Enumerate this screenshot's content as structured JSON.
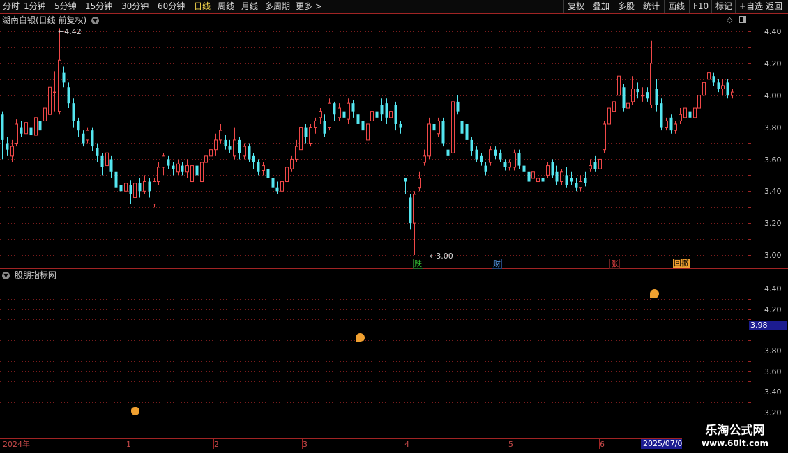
{
  "toolbar": {
    "periods": [
      "分时",
      "1分钟",
      "5分钟",
      "15分钟",
      "30分钟",
      "60分钟",
      "日线",
      "周线",
      "月线",
      "多周期",
      "更多"
    ],
    "active": "日线",
    "more_arrow": ">",
    "right_buttons": [
      "复权",
      "叠加",
      "多股",
      "统计",
      "画线",
      "F10",
      "标记",
      "+自选",
      "返回"
    ]
  },
  "main_panel": {
    "title": "湖南白银(日线 前复权)",
    "high_label": "4.42",
    "low_label": "3.00",
    "axis_labels": [
      "4.40",
      "4.20",
      "4.00",
      "3.80",
      "3.60",
      "3.40",
      "3.20",
      "3.00"
    ],
    "events": [
      {
        "text": "跌",
        "color": "#30c030"
      },
      {
        "text": "财",
        "color": "#5aa8ff"
      },
      {
        "text": "张",
        "color": "#e04040"
      },
      {
        "text": "回撤",
        "color": "#f0a030"
      }
    ]
  },
  "indicator_panel": {
    "title": "股朋指标网",
    "axis_labels": [
      "4.40",
      "4.20",
      "3.80",
      "3.60",
      "3.40",
      "3.20"
    ],
    "current_value": "3.98"
  },
  "date_axis": {
    "labels": [
      "2024年",
      "1",
      "2",
      "3",
      "4",
      "5",
      "6"
    ],
    "current_date": "2025/07/0"
  },
  "watermark": {
    "title": "乐淘公式网",
    "url": "www.60lt.com"
  },
  "colors": {
    "up": "#f04848",
    "down": "#54e6f0",
    "grid": "#7a1c1c",
    "border": "#a02424",
    "highlight": "#1c1c90"
  },
  "chart_data": {
    "type": "candlestick",
    "ylim": [
      2.95,
      4.5
    ],
    "low": 3.0,
    "high": 4.42,
    "candles": [
      [
        3.88,
        3.72,
        3.6,
        3.9
      ],
      [
        3.7,
        3.66,
        3.62,
        3.74
      ],
      [
        3.62,
        3.68,
        3.58,
        3.72
      ],
      [
        3.7,
        3.82,
        3.68,
        3.85
      ],
      [
        3.8,
        3.76,
        3.74,
        3.84
      ],
      [
        3.76,
        3.83,
        3.72,
        3.85
      ],
      [
        3.8,
        3.75,
        3.73,
        3.86
      ],
      [
        3.75,
        3.86,
        3.72,
        3.88
      ],
      [
        3.84,
        3.78,
        3.74,
        3.9
      ],
      [
        3.84,
        3.92,
        3.8,
        4.0
      ],
      [
        3.88,
        4.05,
        3.86,
        4.06
      ],
      [
        4.02,
        4.02,
        3.9,
        4.15
      ],
      [
        3.9,
        4.22,
        3.88,
        4.42
      ],
      [
        4.14,
        4.08,
        4.05,
        4.18
      ],
      [
        4.05,
        3.95,
        3.92,
        4.08
      ],
      [
        3.95,
        3.84,
        3.8,
        3.98
      ],
      [
        3.84,
        3.78,
        3.74,
        3.86
      ],
      [
        3.76,
        3.7,
        3.68,
        3.78
      ],
      [
        3.72,
        3.78,
        3.7,
        3.8
      ],
      [
        3.78,
        3.68,
        3.65,
        3.8
      ],
      [
        3.67,
        3.62,
        3.58,
        3.7
      ],
      [
        3.62,
        3.55,
        3.5,
        3.64
      ],
      [
        3.56,
        3.64,
        3.54,
        3.66
      ],
      [
        3.6,
        3.52,
        3.48,
        3.62
      ],
      [
        3.52,
        3.42,
        3.38,
        3.56
      ],
      [
        3.44,
        3.4,
        3.36,
        3.48
      ],
      [
        3.4,
        3.45,
        3.3,
        3.48
      ],
      [
        3.44,
        3.38,
        3.32,
        3.47
      ],
      [
        3.36,
        3.45,
        3.34,
        3.48
      ],
      [
        3.45,
        3.4,
        3.36,
        3.48
      ],
      [
        3.4,
        3.46,
        3.38,
        3.5
      ],
      [
        3.46,
        3.4,
        3.36,
        3.48
      ],
      [
        3.32,
        3.46,
        3.3,
        3.48
      ],
      [
        3.46,
        3.55,
        3.44,
        3.58
      ],
      [
        3.55,
        3.62,
        3.5,
        3.64
      ],
      [
        3.6,
        3.56,
        3.54,
        3.62
      ],
      [
        3.56,
        3.54,
        3.5,
        3.58
      ],
      [
        3.52,
        3.57,
        3.5,
        3.6
      ],
      [
        3.56,
        3.52,
        3.5,
        3.58
      ],
      [
        3.52,
        3.56,
        3.48,
        3.6
      ],
      [
        3.46,
        3.56,
        3.44,
        3.58
      ],
      [
        3.56,
        3.5,
        3.46,
        3.58
      ],
      [
        3.46,
        3.58,
        3.44,
        3.62
      ],
      [
        3.58,
        3.62,
        3.55,
        3.64
      ],
      [
        3.62,
        3.66,
        3.6,
        3.7
      ],
      [
        3.66,
        3.72,
        3.62,
        3.76
      ],
      [
        3.72,
        3.78,
        3.7,
        3.82
      ],
      [
        3.72,
        3.68,
        3.66,
        3.75
      ],
      [
        3.68,
        3.66,
        3.64,
        3.72
      ],
      [
        3.62,
        3.72,
        3.6,
        3.8
      ],
      [
        3.72,
        3.64,
        3.6,
        3.74
      ],
      [
        3.62,
        3.68,
        3.6,
        3.7
      ],
      [
        3.68,
        3.6,
        3.58,
        3.7
      ],
      [
        3.62,
        3.58,
        3.54,
        3.64
      ],
      [
        3.58,
        3.52,
        3.5,
        3.6
      ],
      [
        3.53,
        3.56,
        3.5,
        3.58
      ],
      [
        3.54,
        3.48,
        3.46,
        3.58
      ],
      [
        3.48,
        3.42,
        3.4,
        3.52
      ],
      [
        3.42,
        3.4,
        3.38,
        3.46
      ],
      [
        3.4,
        3.46,
        3.38,
        3.5
      ],
      [
        3.46,
        3.55,
        3.44,
        3.58
      ],
      [
        3.54,
        3.6,
        3.52,
        3.62
      ],
      [
        3.6,
        3.68,
        3.58,
        3.72
      ],
      [
        3.66,
        3.8,
        3.64,
        3.82
      ],
      [
        3.8,
        3.74,
        3.7,
        3.82
      ],
      [
        3.7,
        3.8,
        3.68,
        3.82
      ],
      [
        3.8,
        3.84,
        3.76,
        3.86
      ],
      [
        3.86,
        3.9,
        3.82,
        3.92
      ],
      [
        3.84,
        3.76,
        3.74,
        3.88
      ],
      [
        3.8,
        3.95,
        3.78,
        3.98
      ],
      [
        3.95,
        3.88,
        3.84,
        3.96
      ],
      [
        3.86,
        3.92,
        3.84,
        3.95
      ],
      [
        3.9,
        3.86,
        3.82,
        3.94
      ],
      [
        3.85,
        3.95,
        3.82,
        3.98
      ],
      [
        3.95,
        3.9,
        3.86,
        3.97
      ],
      [
        3.88,
        3.82,
        3.78,
        3.92
      ],
      [
        3.84,
        3.78,
        3.7,
        3.86
      ],
      [
        3.72,
        3.82,
        3.7,
        3.86
      ],
      [
        3.84,
        3.9,
        3.8,
        3.94
      ],
      [
        3.9,
        3.86,
        3.84,
        4.0
      ],
      [
        3.94,
        3.88,
        3.84,
        3.98
      ],
      [
        3.95,
        3.86,
        3.82,
        3.98
      ],
      [
        3.86,
        3.9,
        3.8,
        4.1
      ],
      [
        3.94,
        3.82,
        3.78,
        3.96
      ],
      [
        3.82,
        3.8,
        3.76,
        3.84
      ],
      [
        3.48,
        3.46,
        3.38,
        3.48
      ],
      [
        3.36,
        3.2,
        3.16,
        3.38
      ],
      [
        3.2,
        3.38,
        3.0,
        3.4
      ],
      [
        3.42,
        3.48,
        3.4,
        3.52
      ],
      [
        3.58,
        3.62,
        3.56,
        3.66
      ],
      [
        3.62,
        3.82,
        3.6,
        3.86
      ],
      [
        3.82,
        3.78,
        3.74,
        3.84
      ],
      [
        3.76,
        3.84,
        3.74,
        3.86
      ],
      [
        3.84,
        3.7,
        3.68,
        3.86
      ],
      [
        3.66,
        3.62,
        3.6,
        3.7
      ],
      [
        3.64,
        3.96,
        3.62,
        3.98
      ],
      [
        3.96,
        3.9,
        3.88,
        4.0
      ],
      [
        3.84,
        3.76,
        3.74,
        3.86
      ],
      [
        3.82,
        3.72,
        3.7,
        3.84
      ],
      [
        3.72,
        3.65,
        3.62,
        3.74
      ],
      [
        3.66,
        3.6,
        3.58,
        3.68
      ],
      [
        3.62,
        3.58,
        3.56,
        3.64
      ],
      [
        3.56,
        3.52,
        3.5,
        3.58
      ],
      [
        3.58,
        3.66,
        3.56,
        3.68
      ],
      [
        3.66,
        3.62,
        3.6,
        3.68
      ],
      [
        3.64,
        3.6,
        3.58,
        3.66
      ],
      [
        3.58,
        3.55,
        3.53,
        3.6
      ],
      [
        3.55,
        3.58,
        3.53,
        3.6
      ],
      [
        3.55,
        3.64,
        3.53,
        3.66
      ],
      [
        3.64,
        3.56,
        3.54,
        3.66
      ],
      [
        3.56,
        3.52,
        3.5,
        3.58
      ],
      [
        3.52,
        3.46,
        3.44,
        3.54
      ],
      [
        3.48,
        3.52,
        3.46,
        3.54
      ],
      [
        3.46,
        3.48,
        3.44,
        3.5
      ],
      [
        3.48,
        3.46,
        3.44,
        3.5
      ],
      [
        3.5,
        3.56,
        3.48,
        3.58
      ],
      [
        3.58,
        3.5,
        3.48,
        3.6
      ],
      [
        3.52,
        3.46,
        3.44,
        3.56
      ],
      [
        3.46,
        3.52,
        3.44,
        3.54
      ],
      [
        3.5,
        3.44,
        3.42,
        3.55
      ],
      [
        3.48,
        3.46,
        3.44,
        3.52
      ],
      [
        3.45,
        3.42,
        3.4,
        3.48
      ],
      [
        3.42,
        3.46,
        3.4,
        3.5
      ],
      [
        3.48,
        3.45,
        3.43,
        3.52
      ],
      [
        3.54,
        3.56,
        3.52,
        3.6
      ],
      [
        3.58,
        3.54,
        3.52,
        3.62
      ],
      [
        3.54,
        3.6,
        3.52,
        3.66
      ],
      [
        3.66,
        3.82,
        3.64,
        3.84
      ],
      [
        3.82,
        3.92,
        3.8,
        3.95
      ],
      [
        3.9,
        3.96,
        3.88,
        4.0
      ],
      [
        4.0,
        4.12,
        3.96,
        4.14
      ],
      [
        4.05,
        3.92,
        3.9,
        4.07
      ],
      [
        3.92,
        3.95,
        3.88,
        3.98
      ],
      [
        3.96,
        4.04,
        3.94,
        4.12
      ],
      [
        4.04,
        4.02,
        3.98,
        4.08
      ],
      [
        4.0,
        4.0,
        3.96,
        4.05
      ],
      [
        4.02,
        3.98,
        3.96,
        4.05
      ],
      [
        3.94,
        4.2,
        3.92,
        4.34
      ],
      [
        4.04,
        3.94,
        3.9,
        4.1
      ],
      [
        3.95,
        3.8,
        3.78,
        3.98
      ],
      [
        3.8,
        3.84,
        3.78,
        3.86
      ],
      [
        3.86,
        3.78,
        3.76,
        3.88
      ],
      [
        3.78,
        3.82,
        3.76,
        3.84
      ],
      [
        3.84,
        3.88,
        3.82,
        3.92
      ],
      [
        3.86,
        3.92,
        3.84,
        3.94
      ],
      [
        3.9,
        3.86,
        3.84,
        3.94
      ],
      [
        3.86,
        3.92,
        3.84,
        3.96
      ],
      [
        3.92,
        4.0,
        3.9,
        4.04
      ],
      [
        4.0,
        4.08,
        3.98,
        4.12
      ],
      [
        4.1,
        4.14,
        4.06,
        4.16
      ],
      [
        4.12,
        4.08,
        4.06,
        4.14
      ],
      [
        4.08,
        4.04,
        4.02,
        4.1
      ],
      [
        4.04,
        4.06,
        4.0,
        4.1
      ],
      [
        4.08,
        4.0,
        3.98,
        4.1
      ],
      [
        4.0,
        4.02,
        3.98,
        4.04
      ]
    ]
  }
}
